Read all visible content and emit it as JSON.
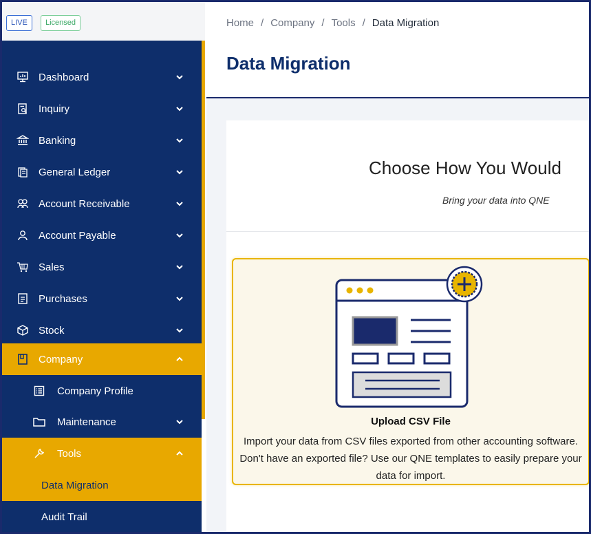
{
  "badges": {
    "live": "LIVE",
    "licensed": "Licensed"
  },
  "sidebar": {
    "items": [
      {
        "label": "Dashboard",
        "icon": "dashboard-icon"
      },
      {
        "label": "Inquiry",
        "icon": "inquiry-icon"
      },
      {
        "label": "Banking",
        "icon": "bank-icon"
      },
      {
        "label": "General Ledger",
        "icon": "ledger-icon"
      },
      {
        "label": "Account Receivable",
        "icon": "receivable-icon"
      },
      {
        "label": "Account Payable",
        "icon": "payable-icon"
      },
      {
        "label": "Sales",
        "icon": "sales-icon"
      },
      {
        "label": "Purchases",
        "icon": "purchases-icon"
      },
      {
        "label": "Stock",
        "icon": "stock-icon"
      },
      {
        "label": "Company",
        "icon": "company-icon"
      },
      {
        "label": "Company Profile",
        "icon": "profile-icon"
      },
      {
        "label": "Maintenance",
        "icon": "folder-icon"
      },
      {
        "label": "Tools",
        "icon": "wrench-icon"
      },
      {
        "label": "Data Migration"
      },
      {
        "label": "Audit Trail"
      }
    ]
  },
  "breadcrumb": {
    "home": "Home",
    "company": "Company",
    "tools": "Tools",
    "current": "Data Migration",
    "separator": "/"
  },
  "page": {
    "title": "Data Migration"
  },
  "card": {
    "heading": "Choose How You Would",
    "subheading": "Bring your data into QNE",
    "option": {
      "title": "Upload CSV File",
      "description": "Import your data from CSV files exported from other accounting software. Don't have an exported file? Use our QNE templates to easily prepare your data for import."
    }
  },
  "colors": {
    "navy": "#0e2e6b",
    "gold": "#e8a800",
    "card_border": "#e8b500"
  }
}
